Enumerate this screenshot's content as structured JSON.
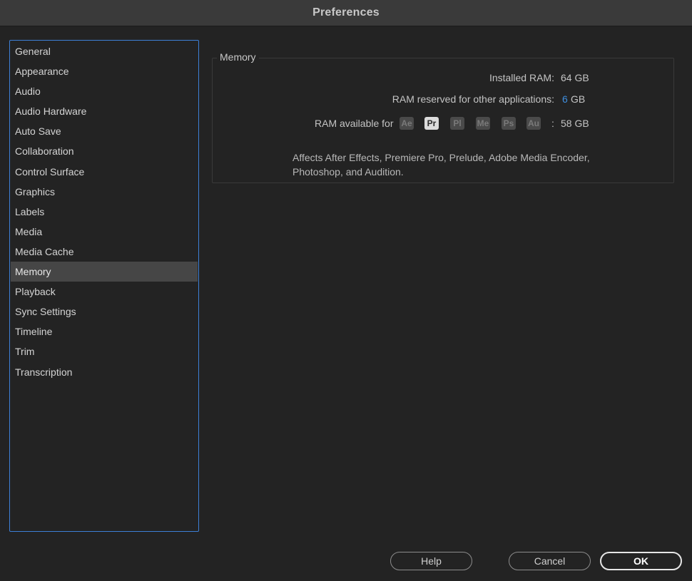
{
  "window": {
    "title": "Preferences"
  },
  "sidebar": {
    "items": [
      {
        "label": "General"
      },
      {
        "label": "Appearance"
      },
      {
        "label": "Audio"
      },
      {
        "label": "Audio Hardware"
      },
      {
        "label": "Auto Save"
      },
      {
        "label": "Collaboration"
      },
      {
        "label": "Control Surface"
      },
      {
        "label": "Graphics"
      },
      {
        "label": "Labels"
      },
      {
        "label": "Media"
      },
      {
        "label": "Media Cache"
      },
      {
        "label": "Memory"
      },
      {
        "label": "Playback"
      },
      {
        "label": "Sync Settings"
      },
      {
        "label": "Timeline"
      },
      {
        "label": "Trim"
      },
      {
        "label": "Transcription"
      }
    ],
    "selected": "Memory"
  },
  "memory": {
    "group_title": "Memory",
    "installed_label": "Installed RAM:",
    "installed_value": "64 GB",
    "reserved_label": "RAM reserved for other applications:",
    "reserved_value": "6",
    "reserved_unit": "GB",
    "available_label": "RAM available for",
    "apps": [
      {
        "abbr": "Ae",
        "icon": "after-effects-icon",
        "active": false
      },
      {
        "abbr": "Pr",
        "icon": "premiere-pro-icon",
        "active": true
      },
      {
        "abbr": "Pl",
        "icon": "prelude-icon",
        "active": false
      },
      {
        "abbr": "Me",
        "icon": "media-encoder-icon",
        "active": false
      },
      {
        "abbr": "Ps",
        "icon": "photoshop-icon",
        "active": false
      },
      {
        "abbr": "Au",
        "icon": "audition-icon",
        "active": false
      }
    ],
    "available_colon": ":",
    "available_value": "58 GB",
    "note_line1": "Affects After Effects, Premiere Pro, Prelude, Adobe Media Encoder,",
    "note_line2": "Photoshop, and Audition."
  },
  "buttons": {
    "help": "Help",
    "cancel": "Cancel",
    "ok": "OK"
  },
  "colors": {
    "accent": "#3f8fe0",
    "sidebar_border": "#3d7fd6",
    "background": "#232323",
    "selected_row": "#464646"
  }
}
